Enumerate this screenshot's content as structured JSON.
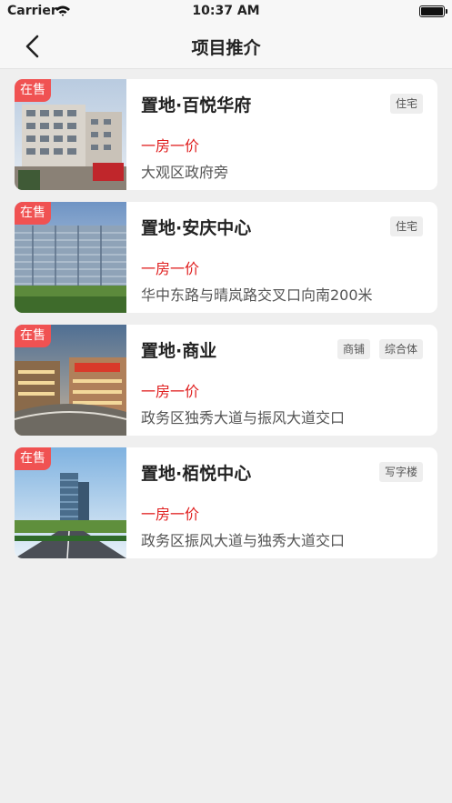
{
  "status_bar": {
    "carrier": "Carrier",
    "time": "10:37 AM"
  },
  "nav": {
    "title": "项目推介"
  },
  "projects": [
    {
      "badge": "在售",
      "title": "置地·百悦华府",
      "tags": [
        "住宅"
      ],
      "price": "一房一价",
      "address": "大观区政府旁"
    },
    {
      "badge": "在售",
      "title": "置地·安庆中心",
      "tags": [
        "住宅"
      ],
      "price": "一房一价",
      "address": "华中东路与晴岚路交叉口向南200米"
    },
    {
      "badge": "在售",
      "title": "置地·商业",
      "tags": [
        "商铺",
        "综合体"
      ],
      "price": "一房一价",
      "address": "政务区独秀大道与振风大道交口"
    },
    {
      "badge": "在售",
      "title": "置地·栢悦中心",
      "tags": [
        "写字楼"
      ],
      "price": "一房一价",
      "address": "政务区振风大道与独秀大道交口"
    }
  ],
  "colors": {
    "badge": "#f05252",
    "price": "#e02020",
    "background": "#efefef"
  }
}
